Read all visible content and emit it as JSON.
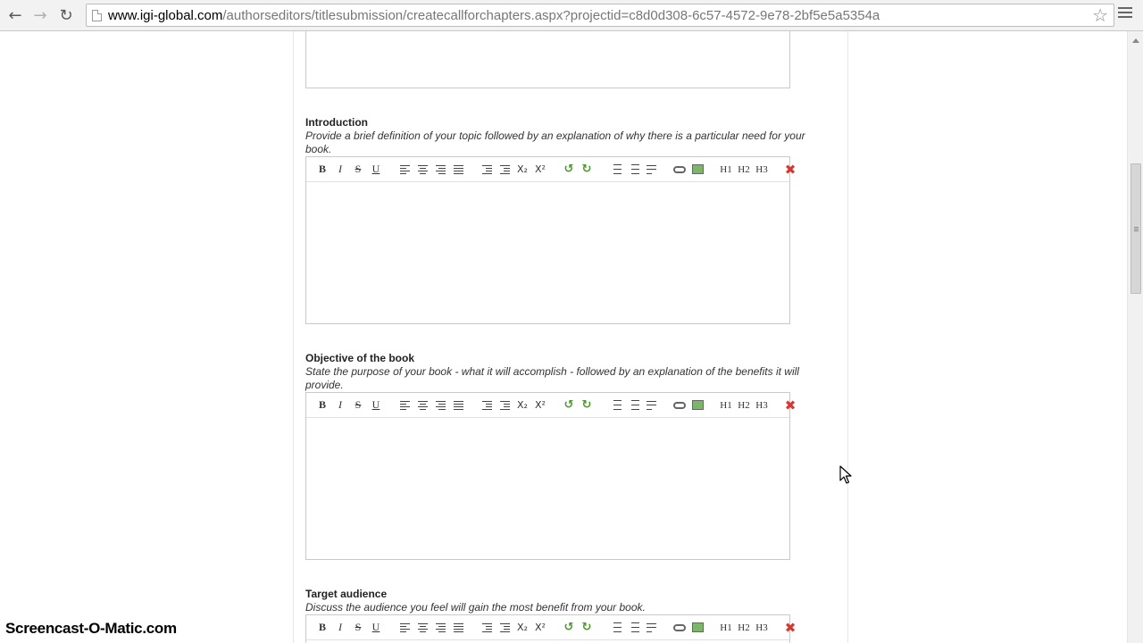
{
  "browser": {
    "url_host": "www.igi-global.com",
    "url_path": "/authorseditors/titlesubmission/createcallforchapters.aspx?projectid=c8d0d308-6c57-4572-9e78-2bf5e5a5354a",
    "back_icon": "arrow-left-icon",
    "forward_icon": "arrow-right-icon",
    "reload_icon": "reload-icon",
    "bookmark_icon": "star-icon",
    "menu_icon": "hamburger-menu-icon"
  },
  "toolbar": {
    "bold": "B",
    "italic": "I",
    "strike": "S",
    "underline": "U",
    "subscript": "X₂",
    "superscript": "X²",
    "undo": "↺",
    "redo": "↻",
    "h1": "H1",
    "h2": "H2",
    "h3": "H3",
    "clear": "✖"
  },
  "sections": [
    {
      "title": "Introduction",
      "description": "Provide a brief definition of your topic followed by an explanation of why there is a particular need for your book."
    },
    {
      "title": "Objective of the book",
      "description": "State the purpose of your book - what it will accomplish - followed by an explanation of the benefits it will provide."
    },
    {
      "title": "Target audience",
      "description": "Discuss the audience you feel will gain the most benefit from your book."
    }
  ],
  "watermark": "Screencast-O-Matic.com",
  "colors": {
    "undo_green": "#4a9a2b",
    "clear_red": "#d9362f",
    "border_gray": "#c9c9c9"
  }
}
